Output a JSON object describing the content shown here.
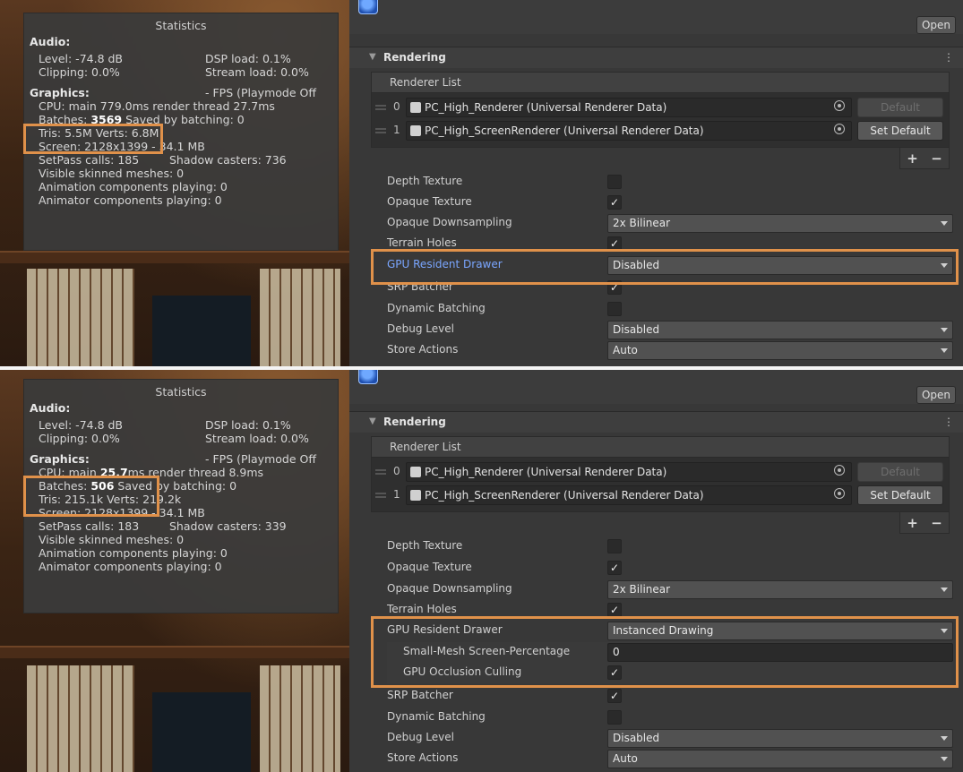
{
  "top": {
    "stats": {
      "title": "Statistics",
      "audio_label": "Audio:",
      "audio_level": "Level: -74.8 dB",
      "dsp_load": "DSP load: 0.1%",
      "clipping": "Clipping: 0.0%",
      "stream_load": "Stream load: 0.0%",
      "graphics_label": "Graphics:",
      "fps": "- FPS (Playmode Off",
      "cpu_line": "CPU: main 779.0ms  render thread 27.7ms",
      "batches_prefix": "Batches: ",
      "batches_value": "3569",
      "saved_by_batching": "  Saved by batching: 0",
      "tris_line": "Tris: 5.5M  Verts: 6.8M",
      "screen": "Screen: 2128x1399 - 34.1 MB",
      "setpass": "SetPass calls: 185",
      "shadow_casters": "Shadow casters: 736",
      "visible_skinned": "Visible skinned meshes: 0",
      "animation_components": "Animation components playing: 0",
      "animator_components": "Animator components playing: 0"
    },
    "inspector": {
      "open": "Open",
      "section": "Rendering",
      "more": "⋮",
      "renderer_list": "Renderer List",
      "renderers": [
        {
          "index": "0",
          "name": "PC_High_Renderer (Universal Renderer Data)",
          "button": "Default"
        },
        {
          "index": "1",
          "name": "PC_High_ScreenRenderer (Universal Renderer Data)",
          "button": "Set Default"
        }
      ],
      "plus": "+",
      "minus": "−",
      "depth_texture": "Depth Texture",
      "opaque_texture": "Opaque Texture",
      "opaque_downsampling": "Opaque Downsampling",
      "opaque_downsampling_value": "2x Bilinear",
      "terrain_holes": "Terrain Holes",
      "gpu_resident_drawer": "GPU Resident Drawer",
      "gpu_resident_drawer_value": "Disabled",
      "srp_batcher": "SRP Batcher",
      "dynamic_batching": "Dynamic Batching",
      "debug_level": "Debug Level",
      "debug_level_value": "Disabled",
      "store_actions": "Store Actions",
      "store_actions_value": "Auto",
      "check": "✓"
    }
  },
  "bottom": {
    "stats": {
      "title": "Statistics",
      "audio_label": "Audio:",
      "audio_level": "Level: -74.8 dB",
      "dsp_load": "DSP load: 0.1%",
      "clipping": "Clipping: 0.0%",
      "stream_load": "Stream load: 0.0%",
      "graphics_label": "Graphics:",
      "fps": "- FPS (Playmode Off",
      "cpu_prefix": "CPU: main ",
      "cpu_value": "25.7",
      "cpu_suffix": "ms  render thread 8.9ms",
      "batches_prefix": "Batches: ",
      "batches_value": "506",
      "saved_by_batching": "  Saved by batching: 0",
      "tris_line": "Tris: 215.1k  Verts: 219.2k",
      "screen": "Screen: 2128x1399 - 34.1 MB",
      "setpass": "SetPass calls: 183",
      "shadow_casters": "Shadow casters: 339",
      "visible_skinned": "Visible skinned meshes: 0",
      "animation_components": "Animation components playing: 0",
      "animator_components": "Animator components playing: 0"
    },
    "inspector": {
      "open": "Open",
      "section": "Rendering",
      "more": "⋮",
      "renderer_list": "Renderer List",
      "renderers": [
        {
          "index": "0",
          "name": "PC_High_Renderer (Universal Renderer Data)",
          "button": "Default"
        },
        {
          "index": "1",
          "name": "PC_High_ScreenRenderer (Universal Renderer Data)",
          "button": "Set Default"
        }
      ],
      "plus": "+",
      "minus": "−",
      "depth_texture": "Depth Texture",
      "opaque_texture": "Opaque Texture",
      "opaque_downsampling": "Opaque Downsampling",
      "opaque_downsampling_value": "2x Bilinear",
      "terrain_holes": "Terrain Holes",
      "gpu_resident_drawer": "GPU Resident Drawer",
      "gpu_resident_drawer_value": "Instanced Drawing",
      "small_mesh": "Small-Mesh Screen-Percentage",
      "small_mesh_value": "0",
      "gpu_occlusion": "GPU Occlusion Culling",
      "srp_batcher": "SRP Batcher",
      "dynamic_batching": "Dynamic Batching",
      "debug_level": "Debug Level",
      "debug_level_value": "Disabled",
      "store_actions": "Store Actions",
      "store_actions_value": "Auto",
      "check": "✓"
    }
  },
  "colors": {
    "highlight": "#e0914a",
    "inspector_bg": "#383838",
    "stats_bg": "#3a3a3a",
    "link_blue": "#7aa6ff"
  }
}
